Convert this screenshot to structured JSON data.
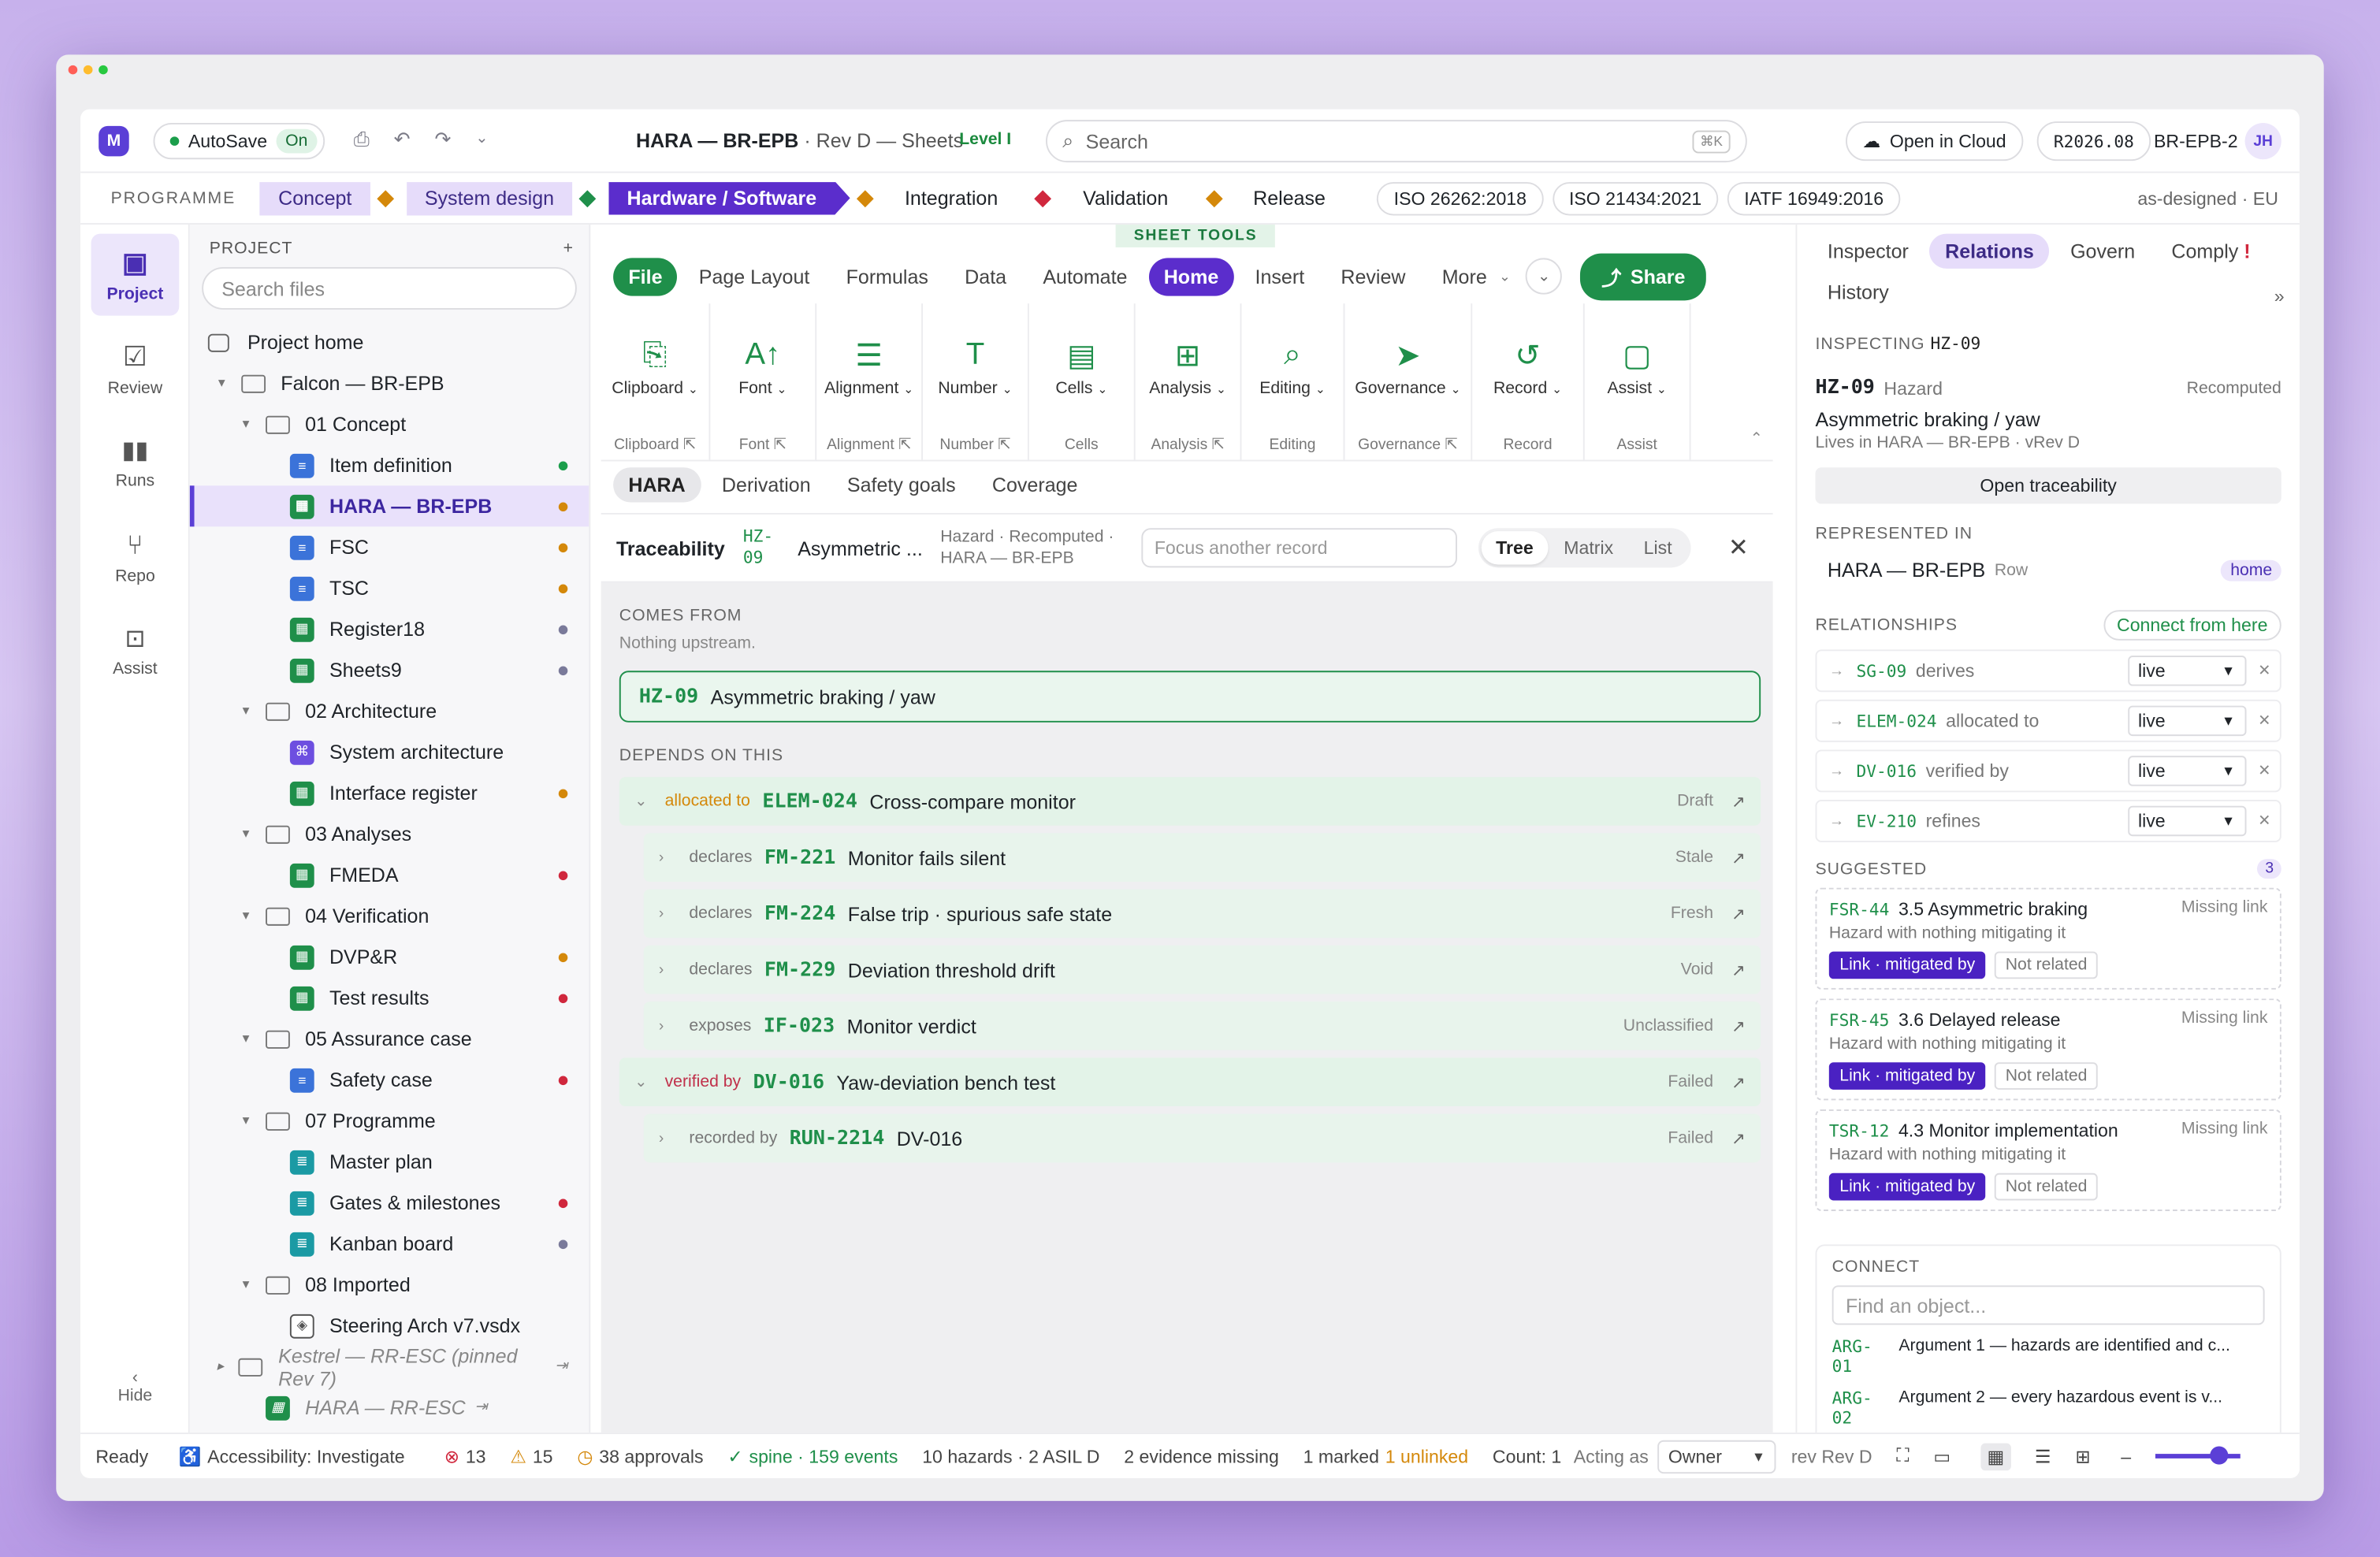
{
  "colors": {
    "accent": "#5b2dcc",
    "green": "#1f8f4a",
    "warn": "#d4880a",
    "bad": "#d0273d"
  },
  "topbar": {
    "autosave_label": "AutoSave",
    "autosave_state": "On",
    "title_bold": "HARA — BR-EPB",
    "title_rest": "· Rev D — Sheets",
    "level": "Level I",
    "search_placeholder": "Search",
    "search_kbd": "⌘K",
    "open_cloud": "Open in Cloud",
    "version": "R2026.08",
    "project": "BR-EPB-2",
    "avatar": "JH"
  },
  "programme": {
    "label": "PROGRAMME",
    "stages": [
      "Concept",
      "System design",
      "Hardware / Software",
      "Integration",
      "Validation",
      "Release"
    ],
    "standards": [
      "ISO 26262:2018",
      "ISO 21434:2021",
      "IATF 16949:2016"
    ],
    "context": "as-designed · EU"
  },
  "rail": {
    "items": [
      "Project",
      "Review",
      "Runs",
      "Repo",
      "Assist"
    ],
    "hide": "Hide"
  },
  "tree": {
    "header": "PROJECT",
    "add": "+",
    "search_placeholder": "Search files",
    "home": "Project home",
    "items": [
      {
        "label": "Falcon — BR-EPB",
        "kind": "folder",
        "depth": 0,
        "chev": "▾"
      },
      {
        "label": "01 Concept",
        "kind": "folder",
        "depth": 1,
        "chev": "▾"
      },
      {
        "label": "Item definition",
        "kind": "doc",
        "depth": 2,
        "dot": "#1b9e4b"
      },
      {
        "label": "HARA — BR-EPB",
        "kind": "sheet",
        "depth": 2,
        "dot": "#d4880a",
        "sel": true
      },
      {
        "label": "FSC",
        "kind": "doc",
        "depth": 2,
        "dot": "#d4880a"
      },
      {
        "label": "TSC",
        "kind": "doc",
        "depth": 2,
        "dot": "#d4880a"
      },
      {
        "label": "Register18",
        "kind": "sheet",
        "depth": 2,
        "dot": "#7a7a9a"
      },
      {
        "label": "Sheets9",
        "kind": "sheet",
        "depth": 2,
        "dot": "#7a7a9a"
      },
      {
        "label": "02 Architecture",
        "kind": "folder",
        "depth": 1,
        "chev": "▾"
      },
      {
        "label": "System architecture",
        "kind": "arch",
        "depth": 2
      },
      {
        "label": "Interface register",
        "kind": "sheet",
        "depth": 2,
        "dot": "#d4880a"
      },
      {
        "label": "03 Analyses",
        "kind": "folder",
        "depth": 1,
        "chev": "▾"
      },
      {
        "label": "FMEDA",
        "kind": "sheet",
        "depth": 2,
        "dot": "#d0273d"
      },
      {
        "label": "04 Verification",
        "kind": "folder",
        "depth": 1,
        "chev": "▾"
      },
      {
        "label": "DVP&R",
        "kind": "sheet",
        "depth": 2,
        "dot": "#d4880a"
      },
      {
        "label": "Test results",
        "kind": "sheet",
        "depth": 2,
        "dot": "#d0273d"
      },
      {
        "label": "05 Assurance case",
        "kind": "folder",
        "depth": 1,
        "chev": "▾"
      },
      {
        "label": "Safety case",
        "kind": "doc",
        "depth": 2,
        "dot": "#d0273d"
      },
      {
        "label": "07 Programme",
        "kind": "folder",
        "depth": 1,
        "chev": "▾"
      },
      {
        "label": "Master plan",
        "kind": "plan",
        "depth": 2
      },
      {
        "label": "Gates & milestones",
        "kind": "plan",
        "depth": 2,
        "dot": "#d0273d"
      },
      {
        "label": "Kanban board",
        "kind": "plan",
        "depth": 2,
        "dot": "#7a7a9a"
      },
      {
        "label": "08 Imported",
        "kind": "folder",
        "depth": 1,
        "chev": "▾"
      },
      {
        "label": "Steering Arch v7.vsdx",
        "kind": "vsdx",
        "depth": 2
      },
      {
        "label": "Kestrel — RR-ESC (pinned Rev 7)",
        "kind": "folder",
        "depth": 0,
        "chev": "▸",
        "muted": true,
        "pin": "⇥"
      },
      {
        "label": "HARA — RR-ESC",
        "kind": "sheet",
        "depth": 1,
        "muted": true,
        "pin": "⇥"
      }
    ]
  },
  "ribbon": {
    "sheet_tools": "SHEET TOOLS",
    "tabs": [
      "File",
      "Page Layout",
      "Formulas",
      "Data",
      "Automate",
      "Home",
      "Insert",
      "Review",
      "More"
    ],
    "share": "Share",
    "groups": [
      {
        "icon": "⎘",
        "label": "Clipboard",
        "foot": "Clipboard ⇱"
      },
      {
        "icon": "A↑",
        "label": "Font",
        "foot": "Font ⇱"
      },
      {
        "icon": "☰",
        "label": "Alignment",
        "foot": "Alignment ⇱"
      },
      {
        "icon": "T",
        "label": "Number",
        "foot": "Number ⇱"
      },
      {
        "icon": "▤",
        "label": "Cells",
        "foot": "Cells"
      },
      {
        "icon": "⊞",
        "label": "Analysis",
        "foot": "Analysis ⇱"
      },
      {
        "icon": "⌕",
        "label": "Editing",
        "foot": "Editing"
      },
      {
        "icon": "➤",
        "label": "Governance",
        "foot": "Governance ⇱"
      },
      {
        "icon": "↺",
        "label": "Record",
        "foot": "Record"
      },
      {
        "icon": "▢",
        "label": "Assist",
        "foot": "Assist"
      }
    ]
  },
  "subtabs": [
    "HARA",
    "Derivation",
    "Safety goals",
    "Coverage"
  ],
  "trace": {
    "label": "Traceability",
    "id": "HZ-09",
    "name": "Asymmetric ...",
    "meta": "Hazard · Recomputed · HARA — BR-EPB",
    "focus_placeholder": "Focus another record",
    "views": [
      "Tree",
      "Matrix",
      "List"
    ],
    "comes_from": "COMES FROM",
    "nothing": "Nothing upstream.",
    "root": {
      "id": "HZ-09",
      "name": "Asymmetric braking / yaw"
    },
    "depends": "DEPENDS ON THIS",
    "rows": [
      {
        "rel": "allocated to",
        "id": "ELEM-024",
        "name": "Cross-compare monitor",
        "status": "Draft",
        "level": 0,
        "tone": "warn"
      },
      {
        "rel": "declares",
        "id": "FM-221",
        "name": "Monitor fails silent",
        "status": "Stale",
        "level": 1
      },
      {
        "rel": "declares",
        "id": "FM-224",
        "name": "False trip · spurious safe state",
        "status": "Fresh",
        "level": 1
      },
      {
        "rel": "declares",
        "id": "FM-229",
        "name": "Deviation threshold drift",
        "status": "Void",
        "level": 1
      },
      {
        "rel": "exposes",
        "id": "IF-023",
        "name": "Monitor verdict",
        "status": "Unclassified",
        "level": 1
      },
      {
        "rel": "verified by",
        "id": "DV-016",
        "name": "Yaw-deviation bench test",
        "status": "Failed",
        "level": 0,
        "tone": "bad"
      },
      {
        "rel": "recorded by",
        "id": "RUN-2214",
        "name": "DV-016",
        "status": "Failed",
        "level": 1
      }
    ]
  },
  "right": {
    "tabs": [
      "Inspector",
      "Relations",
      "Govern",
      "Comply",
      "History"
    ],
    "comply_alert": "!",
    "inspecting_label": "INSPECTING",
    "inspecting_id": "HZ-09",
    "hz_id": "HZ-09",
    "hz_type": "Hazard",
    "hz_state": "Recomputed",
    "hz_name": "Asymmetric braking / yaw",
    "hz_lives": "Lives in HARA — BR-EPB · vRev D",
    "open_trace": "Open traceability",
    "represented_label": "REPRESENTED IN",
    "represented_name": "HARA — BR-EPB",
    "represented_kind": "Row",
    "represented_tag": "home",
    "relationships_label": "RELATIONSHIPS",
    "connect_from": "Connect from here",
    "relationships": [
      {
        "id": "SG-09",
        "verb": "derives",
        "state": "live"
      },
      {
        "id": "ELEM-024",
        "verb": "allocated to",
        "state": "live"
      },
      {
        "id": "DV-016",
        "verb": "verified by",
        "state": "live"
      },
      {
        "id": "EV-210",
        "verb": "refines",
        "state": "live"
      }
    ],
    "suggested_label": "SUGGESTED",
    "suggested_count": "3",
    "suggested": [
      {
        "id": "FSR-44",
        "name": "3.5 Asymmetric braking",
        "tag": "Missing link",
        "desc": "Hazard with nothing mitigating it",
        "link": "Link · mitigated by",
        "no": "Not related"
      },
      {
        "id": "FSR-45",
        "name": "3.6 Delayed release",
        "tag": "Missing link",
        "desc": "Hazard with nothing mitigating it",
        "link": "Link · mitigated by",
        "no": "Not related"
      },
      {
        "id": "TSR-12",
        "name": "4.3 Monitor implementation",
        "tag": "Missing link",
        "desc": "Hazard with nothing mitigating it",
        "link": "Link · mitigated by",
        "no": "Not related"
      }
    ],
    "connect_label": "CONNECT",
    "connect_placeholder": "Find an object...",
    "args": [
      {
        "id": "ARG-01",
        "text": "Argument 1 — hazards are identified and c..."
      },
      {
        "id": "ARG-02",
        "text": "Argument 2 — every hazardous event is v..."
      }
    ]
  },
  "status": {
    "ready": "Ready",
    "a11y": "Accessibility: Investigate",
    "errors": "13",
    "warnings": "15",
    "approvals": "38 approvals",
    "spine": "spine · 159 events",
    "hazards": "10 hazards · 2 ASIL D",
    "evidence": "2 evidence missing",
    "marked": "1 marked",
    "unlinked": "1 unlinked",
    "count": "Count: 1",
    "acting": "Acting as",
    "owner": "Owner",
    "rev": "rev Rev D"
  }
}
